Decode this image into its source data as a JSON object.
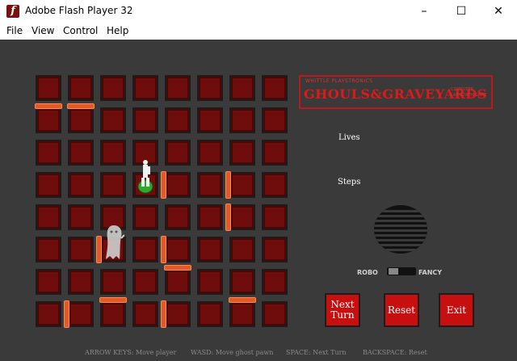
{
  "window": {
    "title": "Adobe Flash Player 32",
    "controls": [
      "–",
      "☐",
      "✕"
    ]
  },
  "menu": [
    "File",
    "View",
    "Control",
    "Help"
  ],
  "game": {
    "logo_top": "WHITTLE PLAYSTRONICS",
    "logo_main": "GHOULS&GRAVEYARDS",
    "logo_sub": "COMPUTER LABYRINTH GAME",
    "lives_label": "Lives",
    "steps_label": "Steps",
    "switch_left": "ROBO",
    "switch_right": "FANCY",
    "buttons": {
      "next_turn": "Next Turn",
      "reset": "Reset",
      "exit": "Exit"
    },
    "help": [
      "ARROW KEYS: Move player",
      "WASD: Move ghost pawn",
      "SPACE: Next Turn",
      "BACKSPACE: Reset"
    ],
    "board": {
      "rows": 8,
      "cols": 8
    },
    "walls": [
      {
        "type": "h",
        "row": 1,
        "col": 0
      },
      {
        "type": "h",
        "row": 1,
        "col": 1
      },
      {
        "type": "v",
        "row": 3,
        "col": 4
      },
      {
        "type": "v",
        "row": 3,
        "col": 6
      },
      {
        "type": "v",
        "row": 4,
        "col": 6
      },
      {
        "type": "v",
        "row": 5,
        "col": 2
      },
      {
        "type": "v",
        "row": 5,
        "col": 4
      },
      {
        "type": "h",
        "row": 6,
        "col": 4
      },
      {
        "type": "h",
        "row": 7,
        "col": 2
      },
      {
        "type": "h",
        "row": 7,
        "col": 6
      },
      {
        "type": "v",
        "row": 7,
        "col": 1
      },
      {
        "type": "v",
        "row": 7,
        "col": 4
      }
    ],
    "colors": {
      "tile": "#6f0c0c",
      "wall": "#e25a2a",
      "button": "#c80f0f",
      "logo": "#e01818"
    }
  }
}
